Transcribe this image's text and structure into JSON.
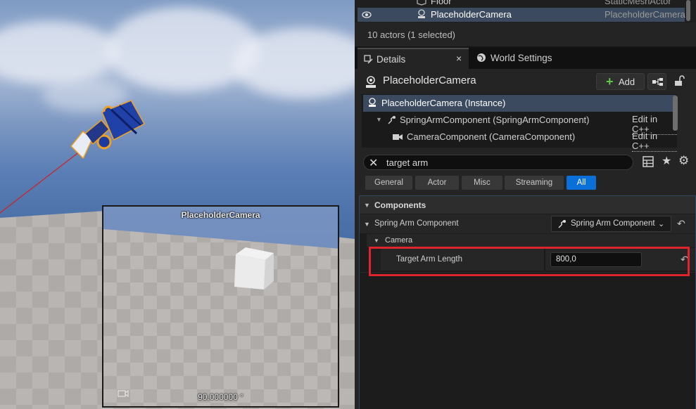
{
  "viewport": {
    "preview_title": "PlaceholderCamera",
    "preview_fov": "90.000000 °"
  },
  "outliner": {
    "rows": [
      {
        "name": "Floor",
        "type": "StaticMeshActor",
        "icon": "static-mesh-icon"
      },
      {
        "name": "PlaceholderCamera",
        "type": "PlaceholderCamera",
        "icon": "actor-icon",
        "selected": true
      }
    ],
    "actor_count": "10 actors (1 selected)"
  },
  "tabs": [
    {
      "label": "Details",
      "close": "×",
      "icon": "details-icon"
    },
    {
      "label": "World Settings",
      "icon": "globe-icon"
    }
  ],
  "details": {
    "actor_name": "PlaceholderCamera",
    "add_label": "Add",
    "add_icon": "+",
    "components": [
      {
        "label": "PlaceholderCamera (Instance)"
      },
      {
        "label": "SpringArmComponent (SpringArmComponent)",
        "edit": "Edit in C++"
      },
      {
        "label": "CameraComponent (CameraComponent)",
        "edit": "Edit in C++"
      }
    ],
    "search": {
      "value": "target arm",
      "clear": "✕"
    },
    "filters": [
      "General",
      "Actor",
      "Misc",
      "Streaming",
      "All"
    ],
    "active_filter": "All",
    "categories": {
      "components": "Components",
      "spring_arm_component": "Spring Arm Component",
      "spring_arm_combo": "Spring Arm Component",
      "camera": "Camera"
    },
    "target_arm_length": {
      "label": "Target Arm Length",
      "value": "800,0"
    },
    "reset_glyph": "↶",
    "star_glyph": "★",
    "gear_glyph": "⚙",
    "chevron_glyph": "⌄",
    "collapse_glyph": "▼"
  },
  "colors": {
    "selection": "#3b4a5e",
    "accent_blue": "#0a6fd8",
    "highlight_red": "#e0242c",
    "add_green": "#62c84c"
  }
}
